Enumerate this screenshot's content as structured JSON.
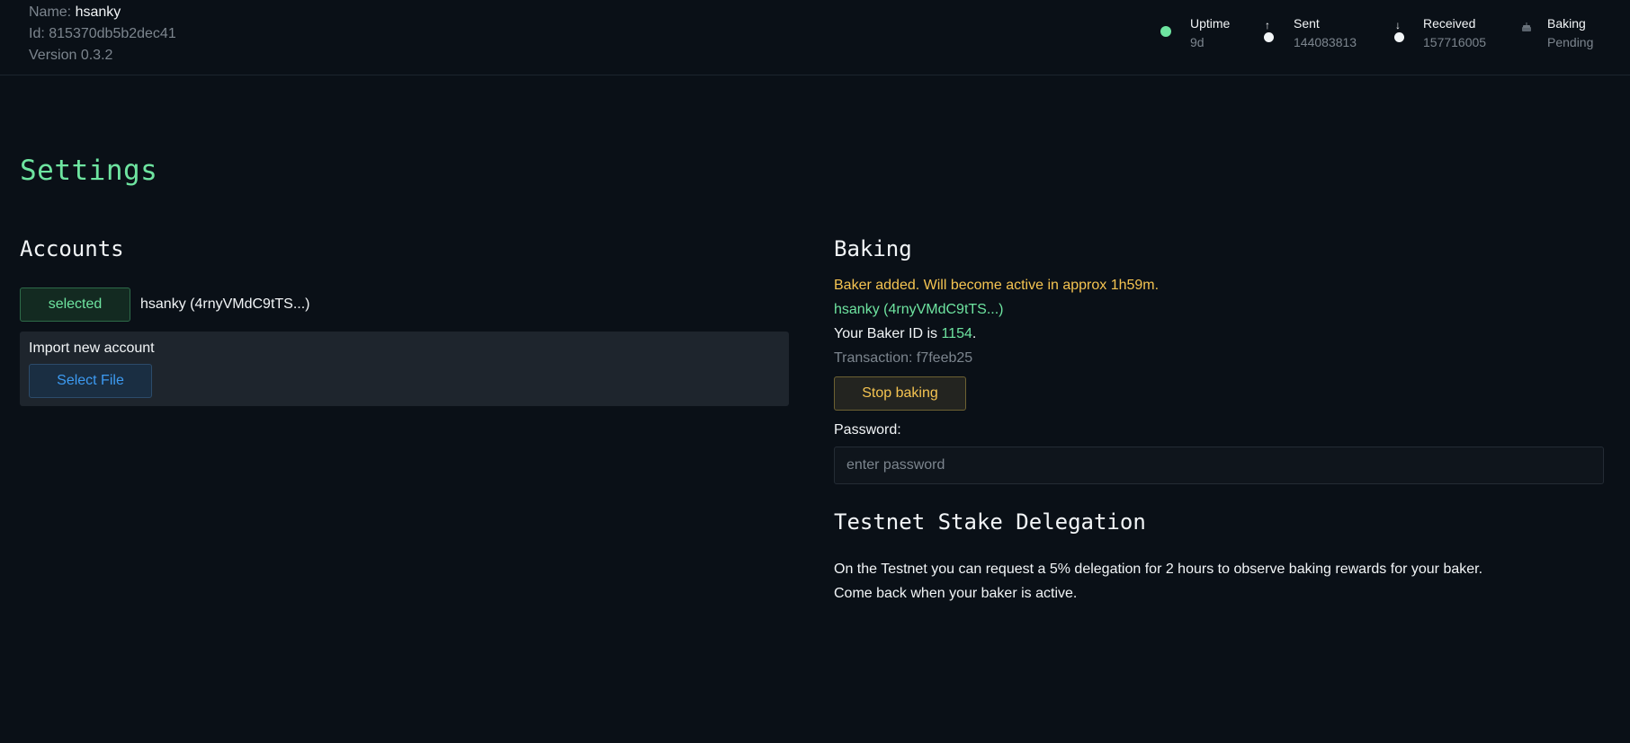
{
  "header": {
    "node": {
      "name_label": "Name:",
      "name_value": "hsanky",
      "id_label": "Id:",
      "id_value": "815370db5b2dec41",
      "version_label": "Version",
      "version_value": "0.3.2"
    },
    "stats": {
      "uptime": {
        "label": "Uptime",
        "value": "9d",
        "dot_color": "#6ee4a0"
      },
      "sent": {
        "label": "Sent",
        "value": "144083813",
        "arrow": "↑"
      },
      "received": {
        "label": "Received",
        "value": "157716005",
        "arrow": "↓"
      },
      "baking": {
        "label": "Baking",
        "value": "Pending",
        "icon": "cake-icon"
      }
    }
  },
  "main": {
    "title": "Settings",
    "accounts": {
      "title": "Accounts",
      "selected_badge": "selected",
      "account_name": "hsanky (4rnyVMdC9tTS...)",
      "import_label": "Import new account",
      "select_file_label": "Select File"
    },
    "baking": {
      "title": "Baking",
      "status_message": "Baker added. Will become active in approx 1h59m.",
      "account": "hsanky (4rnyVMdC9tTS...)",
      "baker_id_prefix": "Your Baker ID is",
      "baker_id": "1154",
      "baker_id_suffix": ".",
      "transaction": "Transaction: f7feeb25",
      "stop_button": "Stop baking",
      "password_label": "Password:",
      "password_placeholder": "enter password"
    },
    "delegation": {
      "title": "Testnet Stake Delegation",
      "line1": "On the Testnet you can request a 5% delegation for 2 hours to observe baking rewards for your baker.",
      "line2": "Come back when your baker is active."
    }
  },
  "colors": {
    "background": "#0a1017",
    "accent_green": "#6ee4a0",
    "accent_yellow": "#f5c451",
    "accent_blue": "#3d9bf2",
    "muted_text": "#7c858e"
  }
}
